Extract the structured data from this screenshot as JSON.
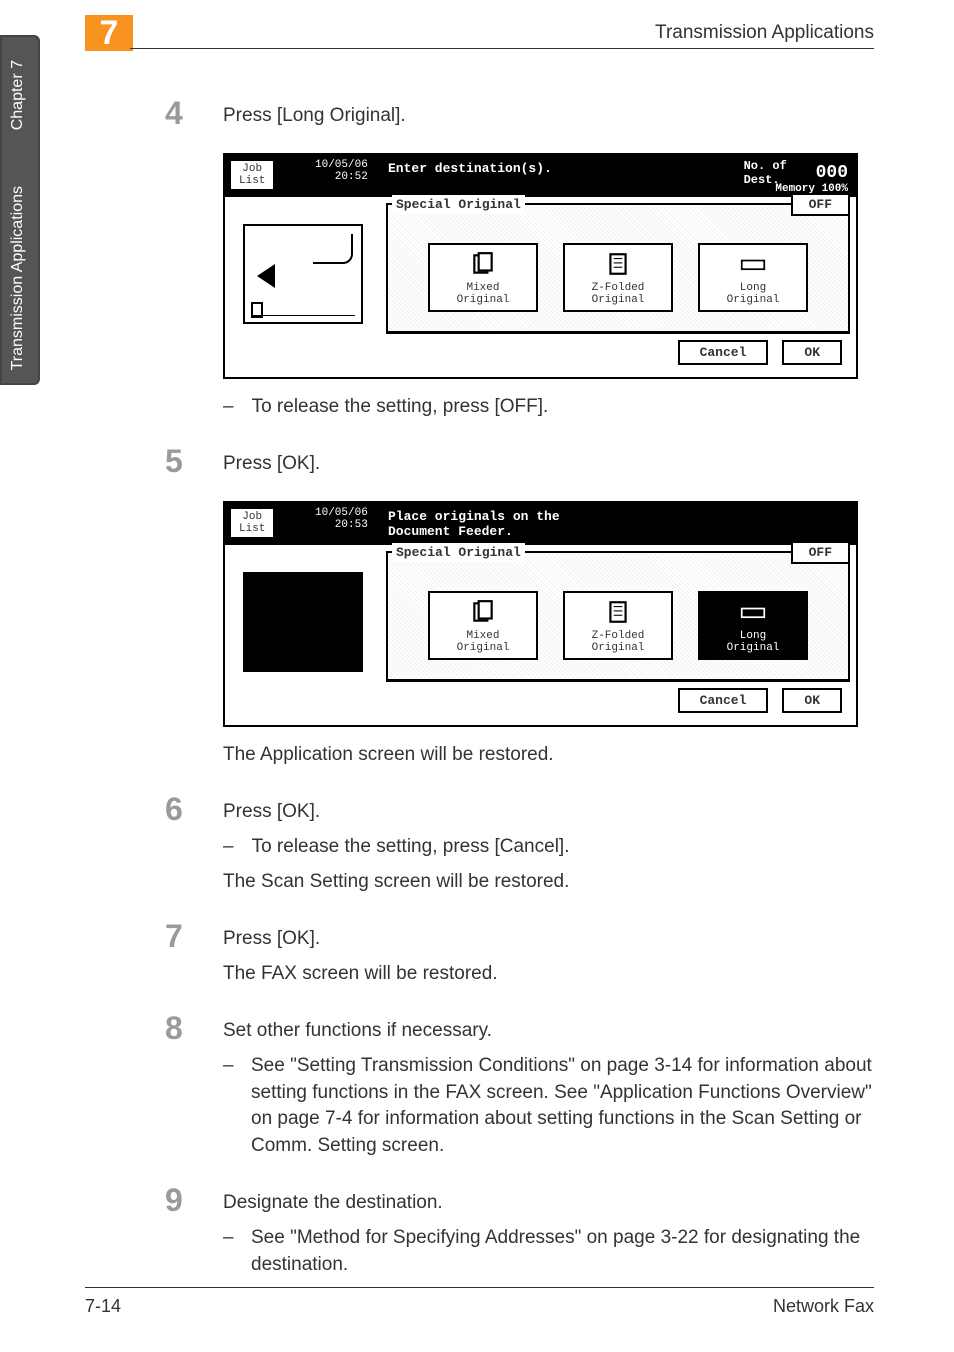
{
  "side": {
    "chapter_label": "Chapter 7",
    "side_title": "Transmission Applications"
  },
  "header": {
    "chapter_num": "7",
    "title": "Transmission Applications"
  },
  "steps": {
    "s4": {
      "num": "4",
      "text": "Press [Long Original].",
      "sub1": "To release the setting, press [OFF]."
    },
    "s5": {
      "num": "5",
      "text": "Press [OK].",
      "caption": "The Application screen will be restored."
    },
    "s6": {
      "num": "6",
      "text": "Press [OK].",
      "sub1": "To release the setting, press [Cancel].",
      "caption": "The Scan Setting screen will be restored."
    },
    "s7": {
      "num": "7",
      "text": "Press [OK].",
      "caption": "The FAX screen will be restored."
    },
    "s8": {
      "num": "8",
      "text": "Set other functions if necessary.",
      "sub1": "See \"Setting Transmission Conditions\" on page 3-14 for information about setting functions in the FAX screen. See \"Application Functions Overview\" on page 7-4 for information about setting functions in the Scan Setting or Comm. Setting screen."
    },
    "s9": {
      "num": "9",
      "text": "Designate the destination.",
      "sub1": "See \"Method for Specifying Addresses\" on page 3-22 for designating the destination."
    }
  },
  "screenshot1": {
    "job_list": "Job\nList",
    "date": "10/05/06",
    "time": "20:52",
    "message": "Enter destination(s).",
    "dest_label": "No. of\nDest.",
    "dest_count": "000",
    "memory": "Memory 100%",
    "panel_title": "Special Original",
    "off": "OFF",
    "opt1": "Mixed\nOriginal",
    "opt2": "Z-Folded\nOriginal",
    "opt3": "Long\nOriginal",
    "cancel": "Cancel",
    "ok": "OK"
  },
  "screenshot2": {
    "job_list": "Job\nList",
    "date": "10/05/06",
    "time": "20:53",
    "message": "Place originals on the\nDocument Feeder.",
    "panel_title": "Special Original",
    "off": "OFF",
    "opt1": "Mixed\nOriginal",
    "opt2": "Z-Folded\nOriginal",
    "opt3": "Long\nOriginal",
    "cancel": "Cancel",
    "ok": "OK"
  },
  "footer": {
    "page": "7-14",
    "doc": "Network Fax"
  }
}
